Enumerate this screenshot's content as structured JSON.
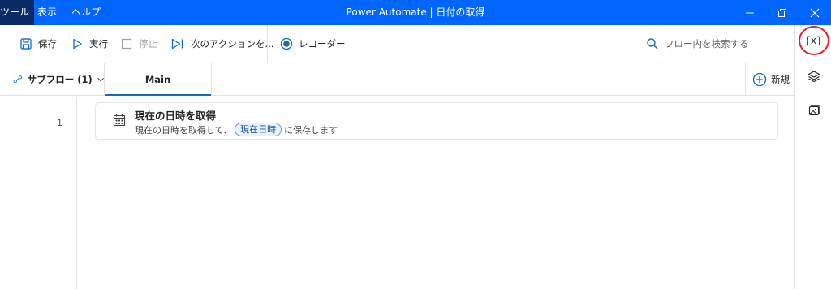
{
  "titlebar": {
    "menu": [
      "ツール",
      "表示",
      "ヘルプ"
    ],
    "title": "Power Automate | 日付の取得",
    "bg_color": "#0066ff"
  },
  "toolbar": {
    "save_label": "保存",
    "run_label": "実行",
    "stop_label": "停止",
    "next_action_label": "次のアクションを...",
    "recorder_label": "レコーダー",
    "search_placeholder": "フロー内を検索する"
  },
  "tabs": {
    "subflow_label": "サブフロー (1)",
    "main_label": "Main",
    "new_label": "新規"
  },
  "flow": {
    "actions": [
      {
        "line": "1",
        "title": "現在の日時を取得",
        "desc_prefix": "現在の日時を取得して、",
        "variable": "現在日時",
        "desc_suffix": "に保存します",
        "icon": "calendar-icon"
      }
    ]
  },
  "right_panel": {
    "variables_label": "{x}",
    "icons": [
      "variables-icon",
      "layers-icon",
      "images-icon"
    ],
    "highlight_color": "#e0202a"
  }
}
